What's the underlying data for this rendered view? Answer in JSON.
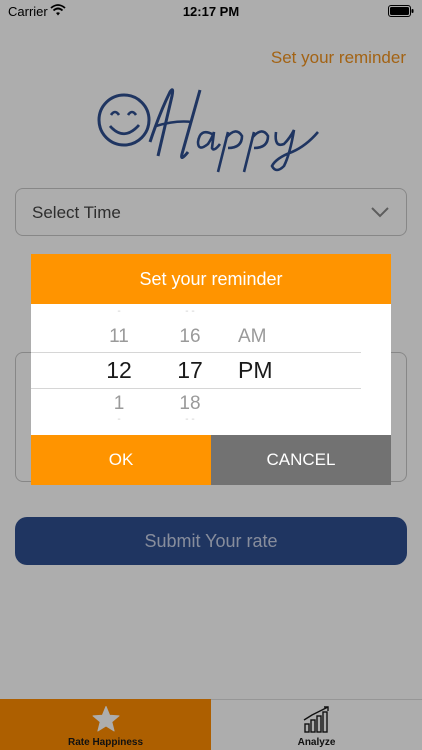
{
  "status_bar": {
    "carrier": "Carrier",
    "time": "12:17 PM"
  },
  "header": {
    "reminder_link": "Set your reminder"
  },
  "select_time": {
    "label": "Select Time"
  },
  "submit": {
    "label": "Submit Your rate"
  },
  "tabs": [
    {
      "label": "Rate Happiness",
      "icon": "star-icon",
      "active": true
    },
    {
      "label": "Analyze",
      "icon": "bar-chart-icon",
      "active": false
    }
  ],
  "dialog": {
    "title": "Set your reminder",
    "hours": {
      "above": "11",
      "selected": "12",
      "below": "1"
    },
    "minutes": {
      "above": "16",
      "selected": "17",
      "below": "18"
    },
    "period": {
      "above": "AM",
      "selected": "PM"
    },
    "ok_label": "OK",
    "cancel_label": "CANCEL"
  },
  "colors": {
    "accent": "#ff9400",
    "primary": "#2f4e8f",
    "cancel": "#727272"
  }
}
